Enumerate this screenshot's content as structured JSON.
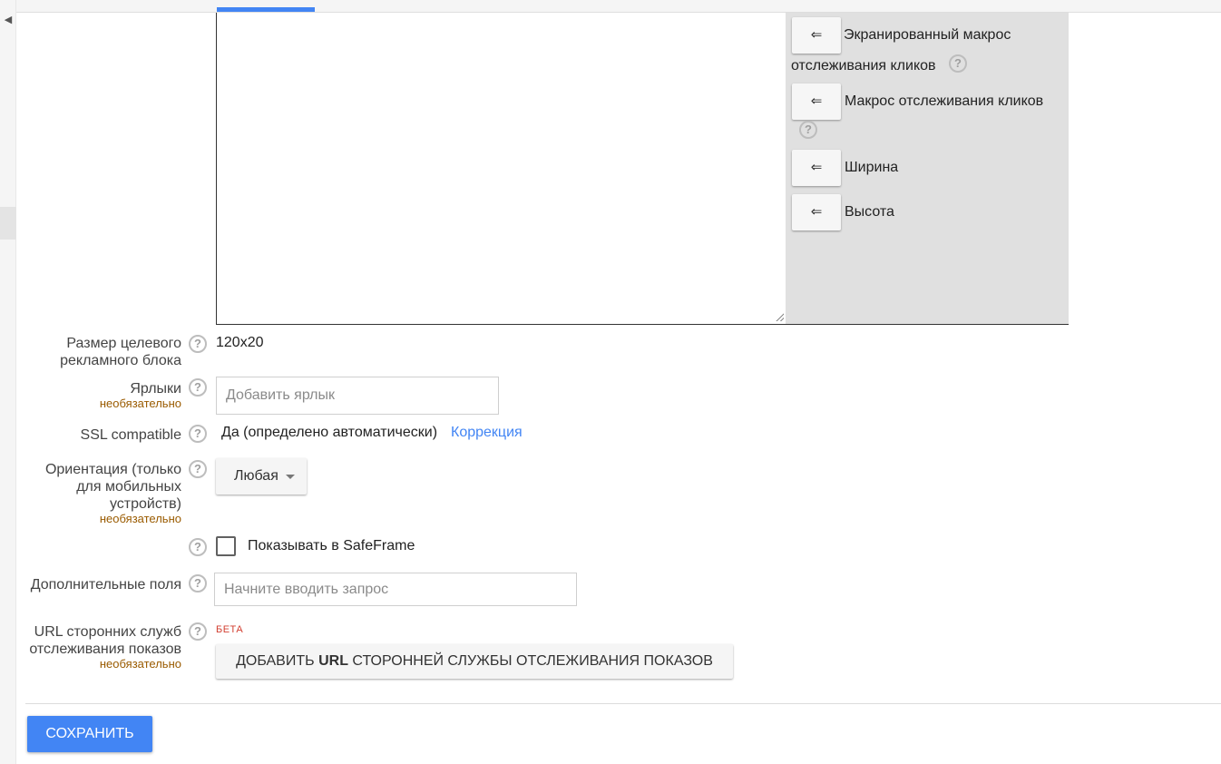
{
  "macros": [
    {
      "arrow": "⇐",
      "label": "Экранированный макрос отслеживания кликов"
    },
    {
      "arrow": "⇐",
      "label": "Макрос отслеживания кликов"
    },
    {
      "arrow": "⇐",
      "label": "Ширина"
    },
    {
      "arrow": "⇐",
      "label": "Высота"
    }
  ],
  "help_glyph": "?",
  "collapse_glyph": "◀",
  "fields": {
    "target_size": {
      "label": "Размер целевого рекламного блока",
      "value": "120x20"
    },
    "labels": {
      "label": "Ярлыки",
      "optional": "необязательно",
      "placeholder": "Добавить ярлык",
      "value": ""
    },
    "ssl": {
      "label": "SSL compatible",
      "value": "Да (определено автоматически)",
      "link": "Коррекция"
    },
    "orientation": {
      "label": "Ориентация (только для мобильных устройств)",
      "optional": "необязательно",
      "selected": "Любая"
    },
    "safeframe": {
      "label": "Показывать в SafeFrame",
      "checked": false
    },
    "extra_fields": {
      "label": "Дополнительные поля",
      "placeholder": "Начните вводить запрос",
      "value": ""
    },
    "tracking_urls": {
      "label": "URL сторонних служб отслеживания показов",
      "optional": "необязательно",
      "badge": "БЕТА",
      "button_pre": "ДОБАВИТЬ ",
      "button_bold": "URL",
      "button_post": " СТОРОННЕЙ СЛУЖБЫ ОТСЛЕЖИВАНИЯ ПОКАЗОВ"
    }
  },
  "save_label": "СОХРАНИТЬ",
  "colors": {
    "accent": "#4285f4",
    "optional": "#9a5b00",
    "beta": "#d23f31",
    "panel": "#e0e0e0"
  }
}
